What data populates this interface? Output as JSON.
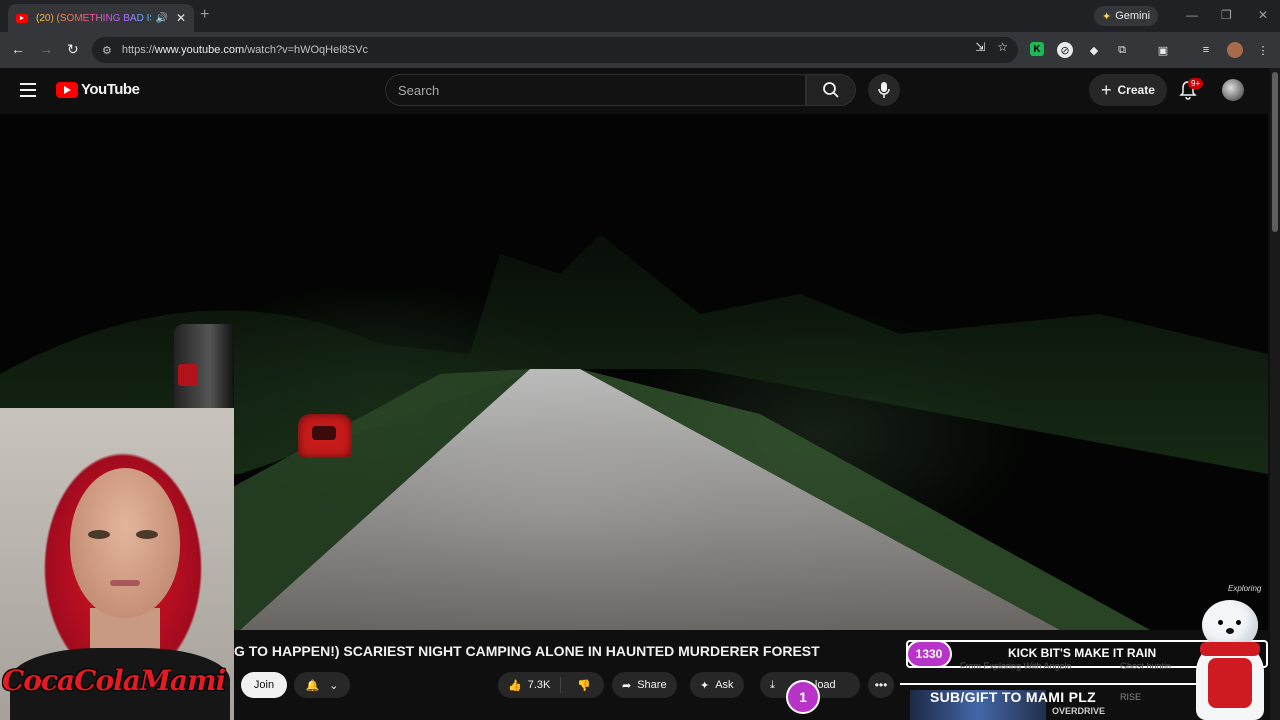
{
  "browser": {
    "tab_title": "(20) (SOMETHING BAD IS G",
    "gemini_label": "Gemini",
    "url_prefix": "https://",
    "url_host": "www.youtube.com",
    "url_path": "/watch?v=hWOqHel8SVc"
  },
  "youtube": {
    "logo_text": "YouTube",
    "search_placeholder": "Search",
    "create_label": "Create",
    "notif_badge": "9+"
  },
  "video": {
    "title_visible": "G TO HAPPEN!) SCARIEST NIGHT CAMPING ALONE IN HAUNTED MURDERER FOREST",
    "join_label": "Join",
    "likes": "7.3K",
    "share_label": "Share",
    "ask_label": "Ask",
    "download_label": "load"
  },
  "stream_overlay": {
    "webcam_signature": "CocaColaMami",
    "counter": "1330",
    "kick_text": "KICK BIT'S MAKE IT RAIN",
    "sub_text": "From Exploring With Angelo",
    "sub_text2": "Ghost huntin",
    "subgift_text": "SUB/GIFT TO MAMI PLZ",
    "circle_count": "1",
    "overdrive": "OVERDRIVE",
    "rise": "RISE",
    "bear_sig": "Exploring"
  }
}
